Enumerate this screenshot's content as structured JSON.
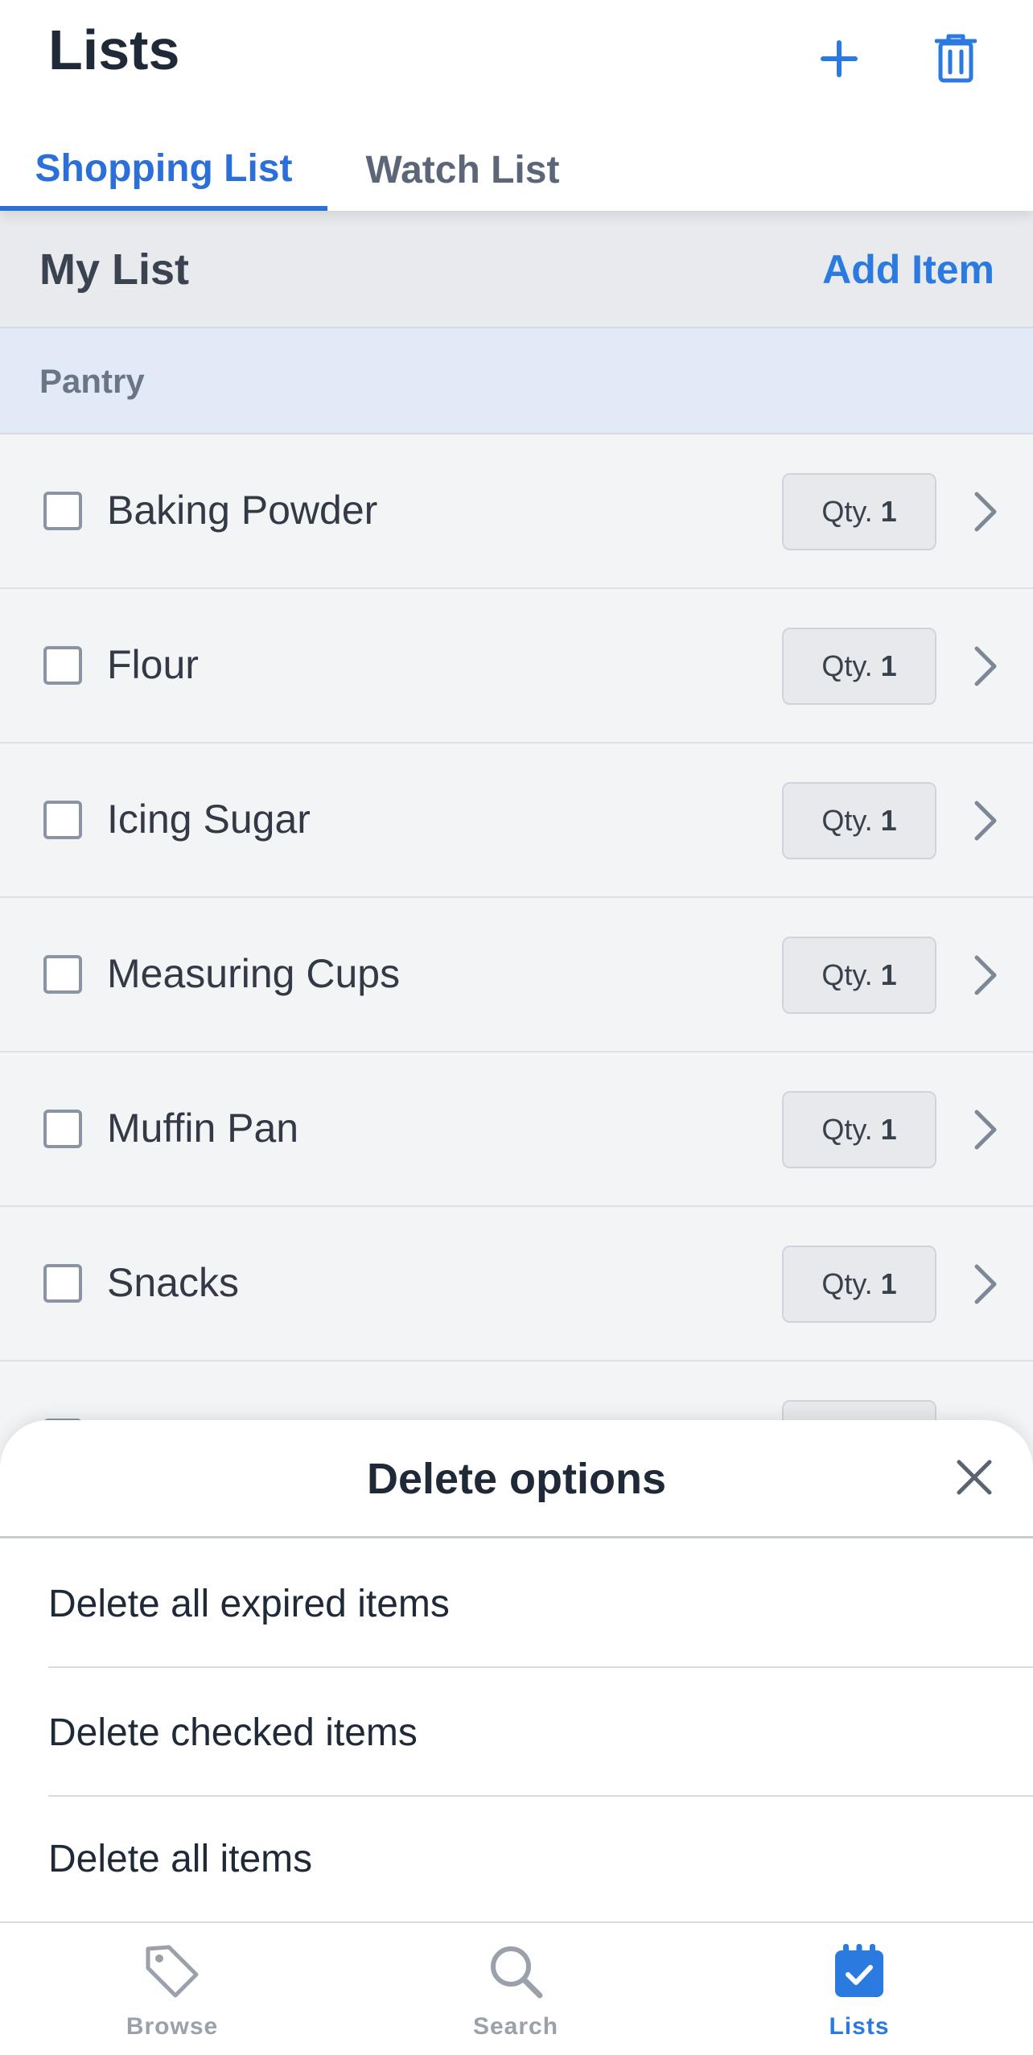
{
  "header": {
    "title": "Lists",
    "icons": {
      "add": "plus-icon",
      "delete": "trash-icon"
    }
  },
  "tabs": [
    {
      "label": "Shopping List",
      "active": true
    },
    {
      "label": "Watch List",
      "active": false
    }
  ],
  "list_bar": {
    "title": "My List",
    "add_item_label": "Add Item"
  },
  "section": {
    "title": "Pantry"
  },
  "items": [
    {
      "name": "Baking Powder",
      "qty_label": "Qty.",
      "qty": "1",
      "checked": false
    },
    {
      "name": "Flour",
      "qty_label": "Qty.",
      "qty": "1",
      "checked": false
    },
    {
      "name": "Icing Sugar",
      "qty_label": "Qty.",
      "qty": "1",
      "checked": false
    },
    {
      "name": "Measuring Cups",
      "qty_label": "Qty.",
      "qty": "1",
      "checked": false
    },
    {
      "name": "Muffin Pan",
      "qty_label": "Qty.",
      "qty": "1",
      "checked": false
    },
    {
      "name": "Snacks",
      "qty_label": "Qty.",
      "qty": "1",
      "checked": false
    }
  ],
  "sheet": {
    "title": "Delete options",
    "options": [
      "Delete all expired items",
      "Delete checked items",
      "Delete all items"
    ]
  },
  "nav": [
    {
      "label": "Browse",
      "icon": "tag-icon",
      "active": false
    },
    {
      "label": "Search",
      "icon": "search-icon",
      "active": false
    },
    {
      "label": "Lists",
      "icon": "calendar-check-icon",
      "active": true
    }
  ],
  "colors": {
    "accent": "#2b7ae0",
    "tab_active": "#2b6fd8",
    "section_bg": "#e2eaf7",
    "muted_text": "#9aa1ab"
  }
}
